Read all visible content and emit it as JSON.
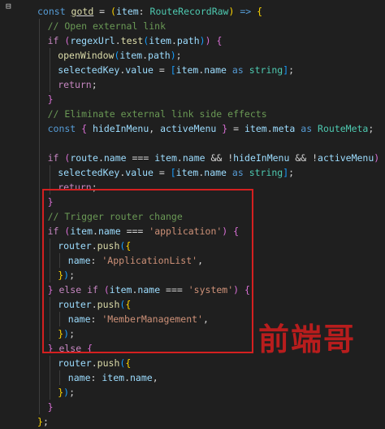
{
  "editor": {
    "gutter_marker": "⊟",
    "lines": [
      {
        "indent": 0,
        "tokens": [
          {
            "c": "kw",
            "t": "const "
          },
          {
            "c": "fn sel-word",
            "t": "gotd"
          },
          {
            "c": "punc",
            "t": " = "
          },
          {
            "c": "brk1",
            "t": "("
          },
          {
            "c": "var",
            "t": "item"
          },
          {
            "c": "punc",
            "t": ": "
          },
          {
            "c": "type",
            "t": "RouteRecordRaw"
          },
          {
            "c": "brk1",
            "t": ")"
          },
          {
            "c": "kw",
            "t": " => "
          },
          {
            "c": "brk1",
            "t": "{"
          }
        ]
      },
      {
        "indent": 1,
        "tokens": [
          {
            "c": "cmt",
            "t": "// Open external link"
          }
        ]
      },
      {
        "indent": 1,
        "tokens": [
          {
            "c": "ctl",
            "t": "if "
          },
          {
            "c": "brk2",
            "t": "("
          },
          {
            "c": "var",
            "t": "regexUrl"
          },
          {
            "c": "punc",
            "t": "."
          },
          {
            "c": "fn",
            "t": "test"
          },
          {
            "c": "brk3",
            "t": "("
          },
          {
            "c": "var",
            "t": "item"
          },
          {
            "c": "punc",
            "t": "."
          },
          {
            "c": "var",
            "t": "path"
          },
          {
            "c": "brk3",
            "t": ")"
          },
          {
            "c": "brk2",
            "t": ")"
          },
          {
            "c": "punc",
            "t": " "
          },
          {
            "c": "brk2",
            "t": "{"
          }
        ]
      },
      {
        "indent": 2,
        "tokens": [
          {
            "c": "fn",
            "t": "openWindow"
          },
          {
            "c": "brk3",
            "t": "("
          },
          {
            "c": "var",
            "t": "item"
          },
          {
            "c": "punc",
            "t": "."
          },
          {
            "c": "var",
            "t": "path"
          },
          {
            "c": "brk3",
            "t": ")"
          },
          {
            "c": "punc",
            "t": ";"
          }
        ]
      },
      {
        "indent": 2,
        "tokens": [
          {
            "c": "var",
            "t": "selectedKey"
          },
          {
            "c": "punc",
            "t": "."
          },
          {
            "c": "var",
            "t": "value"
          },
          {
            "c": "punc",
            "t": " = "
          },
          {
            "c": "brk3",
            "t": "["
          },
          {
            "c": "var",
            "t": "item"
          },
          {
            "c": "punc",
            "t": "."
          },
          {
            "c": "var",
            "t": "name"
          },
          {
            "c": "kw",
            "t": " as "
          },
          {
            "c": "type",
            "t": "string"
          },
          {
            "c": "brk3",
            "t": "]"
          },
          {
            "c": "punc",
            "t": ";"
          }
        ]
      },
      {
        "indent": 2,
        "tokens": [
          {
            "c": "ctl",
            "t": "return"
          },
          {
            "c": "punc",
            "t": ";"
          }
        ]
      },
      {
        "indent": 1,
        "tokens": [
          {
            "c": "brk2",
            "t": "}"
          }
        ]
      },
      {
        "indent": 1,
        "tokens": [
          {
            "c": "cmt",
            "t": "// Eliminate external link side effects"
          }
        ]
      },
      {
        "indent": 1,
        "tokens": [
          {
            "c": "kw",
            "t": "const "
          },
          {
            "c": "brk2",
            "t": "{"
          },
          {
            "c": "var",
            "t": " hideInMenu"
          },
          {
            "c": "punc",
            "t": ", "
          },
          {
            "c": "var",
            "t": "activeMenu "
          },
          {
            "c": "brk2",
            "t": "}"
          },
          {
            "c": "punc",
            "t": " = "
          },
          {
            "c": "var",
            "t": "item"
          },
          {
            "c": "punc",
            "t": "."
          },
          {
            "c": "var",
            "t": "meta"
          },
          {
            "c": "kw",
            "t": " as "
          },
          {
            "c": "type",
            "t": "RouteMeta"
          },
          {
            "c": "punc",
            "t": ";"
          }
        ]
      },
      {
        "indent": 1,
        "tokens": []
      },
      {
        "indent": 1,
        "tokens": [
          {
            "c": "ctl",
            "t": "if "
          },
          {
            "c": "brk2",
            "t": "("
          },
          {
            "c": "var",
            "t": "route"
          },
          {
            "c": "punc",
            "t": "."
          },
          {
            "c": "var",
            "t": "name"
          },
          {
            "c": "punc",
            "t": " === "
          },
          {
            "c": "var",
            "t": "item"
          },
          {
            "c": "punc",
            "t": "."
          },
          {
            "c": "var",
            "t": "name"
          },
          {
            "c": "punc",
            "t": " && !"
          },
          {
            "c": "var",
            "t": "hideInMenu"
          },
          {
            "c": "punc",
            "t": " && !"
          },
          {
            "c": "var",
            "t": "activeMenu"
          },
          {
            "c": "brk2",
            "t": ")"
          },
          {
            "c": "punc",
            "t": " "
          },
          {
            "c": "brk2",
            "t": "{"
          }
        ]
      },
      {
        "indent": 2,
        "tokens": [
          {
            "c": "var",
            "t": "selectedKey"
          },
          {
            "c": "punc",
            "t": "."
          },
          {
            "c": "var",
            "t": "value"
          },
          {
            "c": "punc",
            "t": " = "
          },
          {
            "c": "brk3",
            "t": "["
          },
          {
            "c": "var",
            "t": "item"
          },
          {
            "c": "punc",
            "t": "."
          },
          {
            "c": "var",
            "t": "name"
          },
          {
            "c": "kw",
            "t": " as "
          },
          {
            "c": "type",
            "t": "string"
          },
          {
            "c": "brk3",
            "t": "]"
          },
          {
            "c": "punc",
            "t": ";"
          }
        ]
      },
      {
        "indent": 2,
        "tokens": [
          {
            "c": "ctl",
            "t": "return"
          },
          {
            "c": "punc",
            "t": ";"
          }
        ]
      },
      {
        "indent": 1,
        "tokens": [
          {
            "c": "brk2",
            "t": "}"
          }
        ]
      },
      {
        "indent": 1,
        "tokens": [
          {
            "c": "cmt",
            "t": "// Trigger router change"
          }
        ]
      },
      {
        "indent": 1,
        "tokens": [
          {
            "c": "ctl",
            "t": "if "
          },
          {
            "c": "brk2",
            "t": "("
          },
          {
            "c": "var",
            "t": "item"
          },
          {
            "c": "punc",
            "t": "."
          },
          {
            "c": "var",
            "t": "name"
          },
          {
            "c": "punc",
            "t": " === "
          },
          {
            "c": "str",
            "t": "'application'"
          },
          {
            "c": "brk2",
            "t": ")"
          },
          {
            "c": "punc",
            "t": " "
          },
          {
            "c": "brk2",
            "t": "{"
          }
        ]
      },
      {
        "indent": 2,
        "tokens": [
          {
            "c": "var",
            "t": "router"
          },
          {
            "c": "punc",
            "t": "."
          },
          {
            "c": "fn",
            "t": "push"
          },
          {
            "c": "brk3",
            "t": "("
          },
          {
            "c": "brk1",
            "t": "{"
          }
        ]
      },
      {
        "indent": 3,
        "tokens": [
          {
            "c": "var",
            "t": "name"
          },
          {
            "c": "punc",
            "t": ": "
          },
          {
            "c": "str",
            "t": "'ApplicationList'"
          },
          {
            "c": "punc",
            "t": ","
          }
        ]
      },
      {
        "indent": 2,
        "tokens": [
          {
            "c": "brk1",
            "t": "}"
          },
          {
            "c": "brk3",
            "t": ")"
          },
          {
            "c": "punc",
            "t": ";"
          }
        ]
      },
      {
        "indent": 1,
        "tokens": [
          {
            "c": "brk2",
            "t": "}"
          },
          {
            "c": "ctl",
            "t": " else if "
          },
          {
            "c": "brk2",
            "t": "("
          },
          {
            "c": "var",
            "t": "item"
          },
          {
            "c": "punc",
            "t": "."
          },
          {
            "c": "var",
            "t": "name"
          },
          {
            "c": "punc",
            "t": " === "
          },
          {
            "c": "str",
            "t": "'system'"
          },
          {
            "c": "brk2",
            "t": ")"
          },
          {
            "c": "punc",
            "t": " "
          },
          {
            "c": "brk2",
            "t": "{"
          }
        ]
      },
      {
        "indent": 2,
        "tokens": [
          {
            "c": "var",
            "t": "router"
          },
          {
            "c": "punc",
            "t": "."
          },
          {
            "c": "fn",
            "t": "push"
          },
          {
            "c": "brk3",
            "t": "("
          },
          {
            "c": "brk1",
            "t": "{"
          }
        ]
      },
      {
        "indent": 3,
        "tokens": [
          {
            "c": "var",
            "t": "name"
          },
          {
            "c": "punc",
            "t": ": "
          },
          {
            "c": "str",
            "t": "'MemberManagement'"
          },
          {
            "c": "punc",
            "t": ","
          }
        ]
      },
      {
        "indent": 2,
        "tokens": [
          {
            "c": "brk1",
            "t": "}"
          },
          {
            "c": "brk3",
            "t": ")"
          },
          {
            "c": "punc",
            "t": ";"
          }
        ]
      },
      {
        "indent": 1,
        "tokens": [
          {
            "c": "brk2",
            "t": "}"
          },
          {
            "c": "ctl",
            "t": " else "
          },
          {
            "c": "brk2",
            "t": "{"
          }
        ]
      },
      {
        "indent": 2,
        "tokens": [
          {
            "c": "var",
            "t": "router"
          },
          {
            "c": "punc",
            "t": "."
          },
          {
            "c": "fn",
            "t": "push"
          },
          {
            "c": "brk3",
            "t": "("
          },
          {
            "c": "brk1",
            "t": "{"
          }
        ]
      },
      {
        "indent": 3,
        "tokens": [
          {
            "c": "var",
            "t": "name"
          },
          {
            "c": "punc",
            "t": ": "
          },
          {
            "c": "var",
            "t": "item"
          },
          {
            "c": "punc",
            "t": "."
          },
          {
            "c": "var",
            "t": "name"
          },
          {
            "c": "punc",
            "t": ","
          }
        ]
      },
      {
        "indent": 2,
        "tokens": [
          {
            "c": "brk1",
            "t": "}"
          },
          {
            "c": "brk3",
            "t": ")"
          },
          {
            "c": "punc",
            "t": ";"
          }
        ]
      },
      {
        "indent": 1,
        "tokens": [
          {
            "c": "brk2",
            "t": "}"
          }
        ]
      },
      {
        "indent": 0,
        "tokens": [
          {
            "c": "brk1",
            "t": "}"
          },
          {
            "c": "punc",
            "t": ";"
          }
        ]
      }
    ]
  },
  "watermark": "前端哥",
  "colors": {
    "background": "#1f1f1f",
    "highlight_box": "#d42020",
    "watermark": "#b81d1d"
  }
}
